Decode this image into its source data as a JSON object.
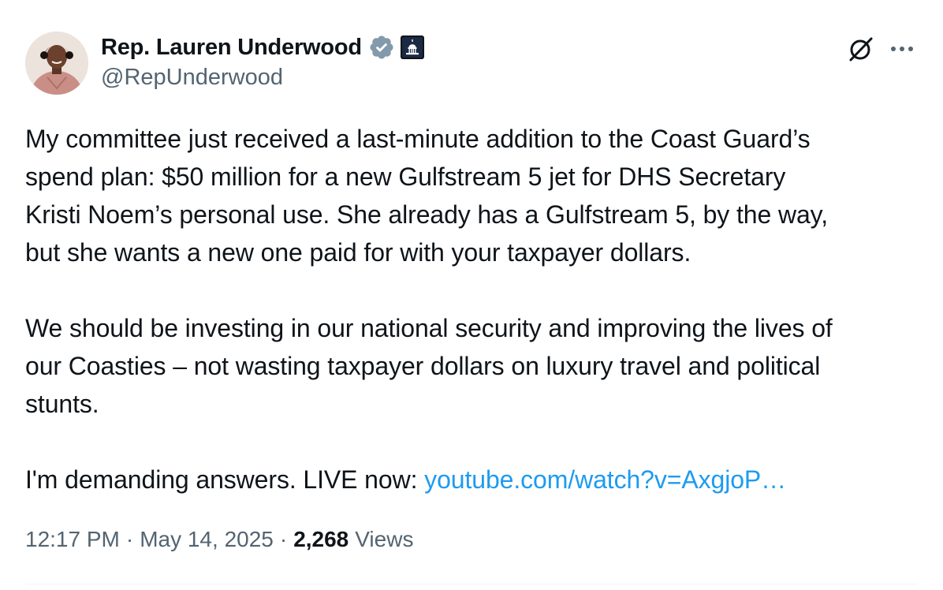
{
  "author": {
    "display_name": "Rep. Lauren Underwood",
    "handle": "@RepUnderwood",
    "verified_badge": "verified-check-icon",
    "affiliation_badge": "us-capitol-icon"
  },
  "actions": {
    "grok_icon": "grok-icon",
    "more_icon": "more-horizontal-icon"
  },
  "tweet": {
    "paragraph_1": "My committee just received a last-minute addition to the Coast Guard’s\nspend plan: $50 million for a new Gulfstream 5 jet for DHS Secretary\nKristi Noem’s personal use. She already has a Gulfstream 5, by the way,\nbut she wants a new one paid for with your taxpayer dollars.",
    "paragraph_2": "We should be investing in our national security and improving the lives of\nour Coasties – not wasting taxpayer dollars on luxury travel and political\nstunts.",
    "paragraph_3_prefix": "I'm demanding answers. LIVE now: ",
    "link_text": "youtube.com/watch?v=AxgjoP…"
  },
  "meta": {
    "time": "12:17 PM",
    "separator": "·",
    "date": "May 14, 2025",
    "views_count": "2,268",
    "views_label": "Views"
  },
  "colors": {
    "text": "#0f1419",
    "secondary": "#536471",
    "link": "#1d9bf0",
    "verified": "#829aab"
  }
}
